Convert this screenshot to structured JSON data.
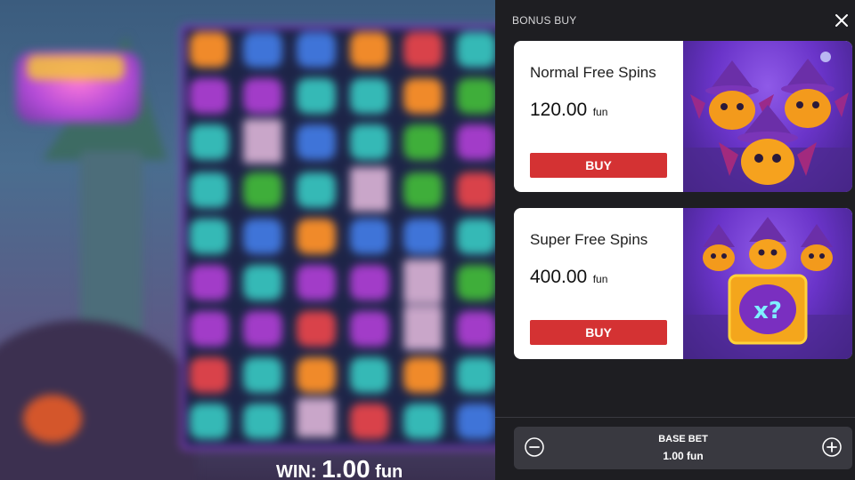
{
  "game": {
    "win_label": "WIN:",
    "win_amount": "1.00",
    "win_unit": "fun"
  },
  "panel": {
    "title": "BONUS BUY",
    "close_icon": "close-icon"
  },
  "cards": [
    {
      "name": "Normal Free Spins",
      "price": "120.00",
      "currency": "fun",
      "buy_label": "BUY",
      "art": "witch-pumpkins-artwork"
    },
    {
      "name": "Super Free Spins",
      "price": "400.00",
      "currency": "fun",
      "buy_label": "BUY",
      "art": "witch-pumpkins-multiplier-artwork"
    }
  ],
  "bet": {
    "label": "BASE BET",
    "value": "1.00 fun",
    "minus_icon": "minus-circle-icon",
    "plus_icon": "plus-circle-icon"
  },
  "colors": {
    "buy_button": "#d43233",
    "panel_bg": "#1e1e22",
    "card_bg": "#ffffff"
  }
}
